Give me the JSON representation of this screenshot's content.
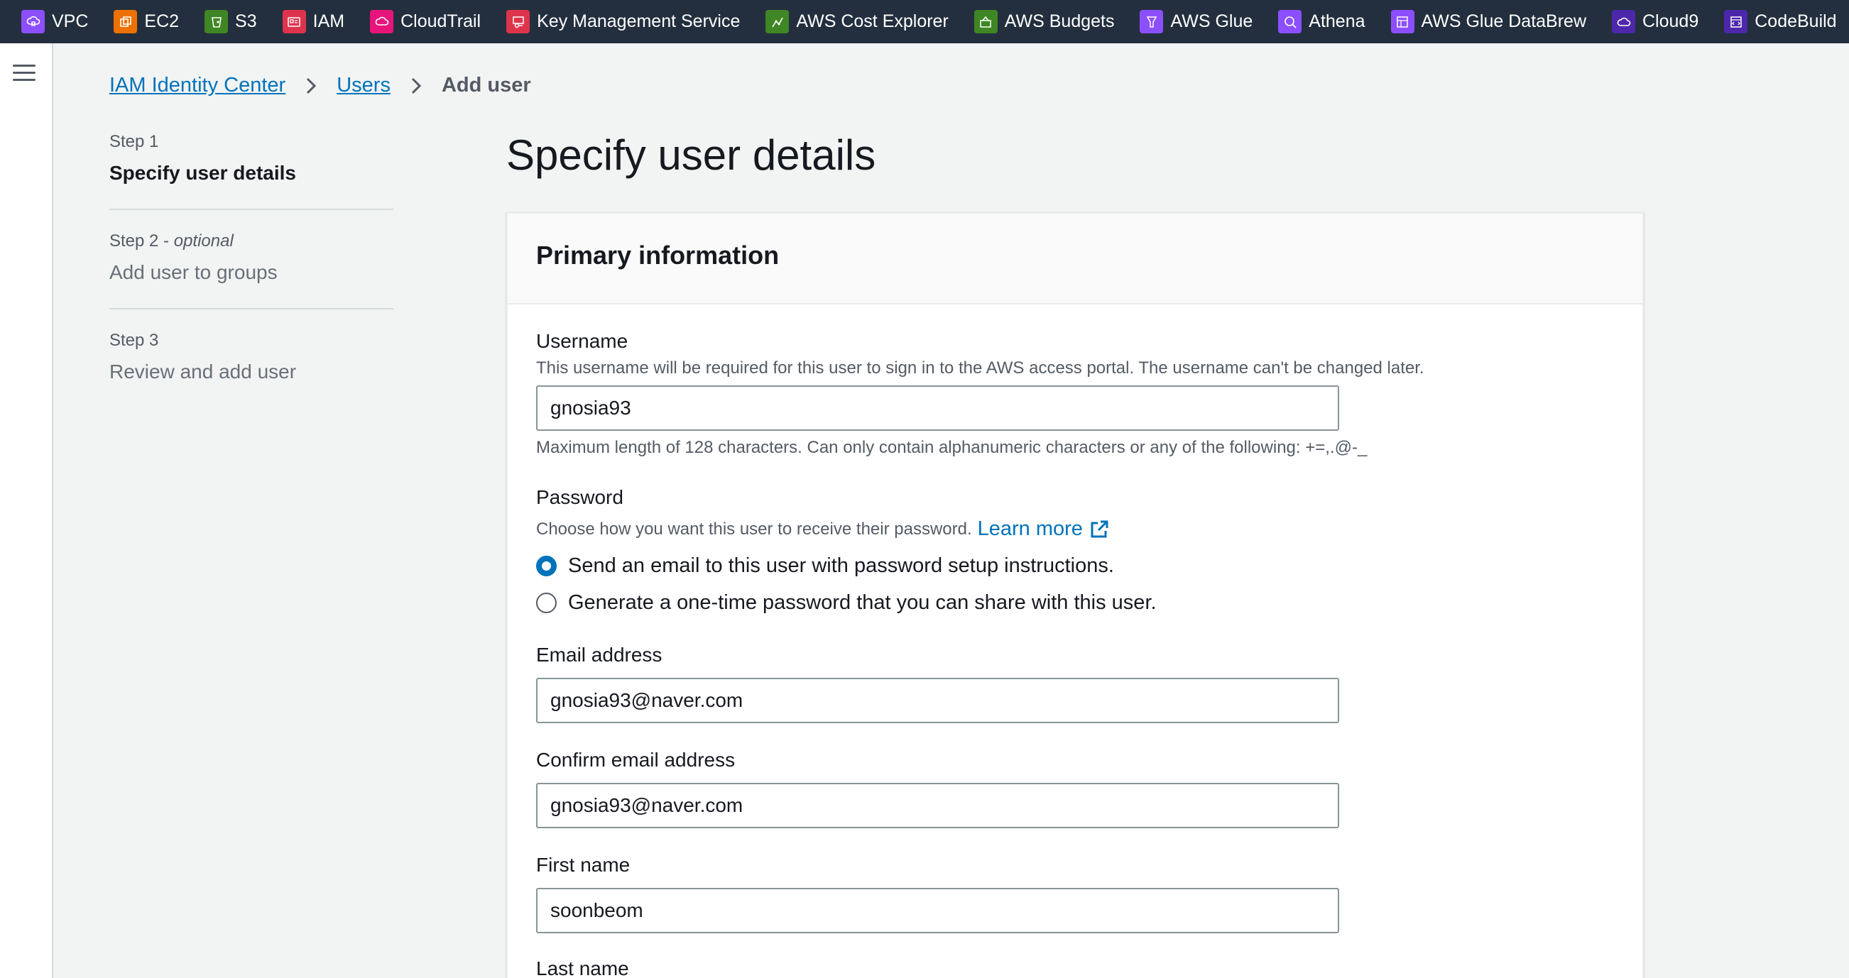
{
  "favorites": [
    {
      "label": "VPC",
      "icon": "vpc-icon",
      "color": "#8c4fff"
    },
    {
      "label": "EC2",
      "icon": "ec2-icon",
      "color": "#ed7100"
    },
    {
      "label": "S3",
      "icon": "s3-icon",
      "color": "#3f8624"
    },
    {
      "label": "IAM",
      "icon": "iam-icon",
      "color": "#dd344c"
    },
    {
      "label": "CloudTrail",
      "icon": "cloudtrail-icon",
      "color": "#e7157b"
    },
    {
      "label": "Key Management Service",
      "icon": "kms-icon",
      "color": "#dd344c"
    },
    {
      "label": "AWS Cost Explorer",
      "icon": "cost-explorer-icon",
      "color": "#3f8624"
    },
    {
      "label": "AWS Budgets",
      "icon": "budgets-icon",
      "color": "#3f8624"
    },
    {
      "label": "AWS Glue",
      "icon": "glue-icon",
      "color": "#8c4fff"
    },
    {
      "label": "Athena",
      "icon": "athena-icon",
      "color": "#8c4fff"
    },
    {
      "label": "AWS Glue DataBrew",
      "icon": "databrew-icon",
      "color": "#8c4fff"
    },
    {
      "label": "Cloud9",
      "icon": "cloud9-icon",
      "color": "#4d27aa"
    },
    {
      "label": "CodeBuild",
      "icon": "codebuild-icon",
      "color": "#4d27aa"
    }
  ],
  "breadcrumb": {
    "root": "IAM Identity Center",
    "users": "Users",
    "current": "Add user"
  },
  "steps": [
    {
      "num": "Step 1",
      "optional": "",
      "title": "Specify user details"
    },
    {
      "num": "Step 2",
      "optional": "optional",
      "title": "Add user to groups"
    },
    {
      "num": "Step 3",
      "optional": "",
      "title": "Review and add user"
    }
  ],
  "page": {
    "title": "Specify user details"
  },
  "primary": {
    "header": "Primary information",
    "username": {
      "label": "Username",
      "description": "This username will be required for this user to sign in to the AWS access portal. The username can't be changed later.",
      "value": "gnosia93",
      "constraint": "Maximum length of 128 characters. Can only contain alphanumeric characters or any of the following: +=,.@-_"
    },
    "password": {
      "label": "Password",
      "description": "Choose how you want this user to receive their password.",
      "learn_more": "Learn more",
      "options": [
        {
          "label": "Send an email to this user with password setup instructions.",
          "checked": true
        },
        {
          "label": "Generate a one-time password that you can share with this user.",
          "checked": false
        }
      ]
    },
    "email": {
      "label": "Email address",
      "value": "gnosia93@naver.com"
    },
    "confirm_email": {
      "label": "Confirm email address",
      "value": "gnosia93@naver.com"
    },
    "first_name": {
      "label": "First name",
      "value": "soonbeom"
    },
    "last_name": {
      "label": "Last name"
    }
  }
}
